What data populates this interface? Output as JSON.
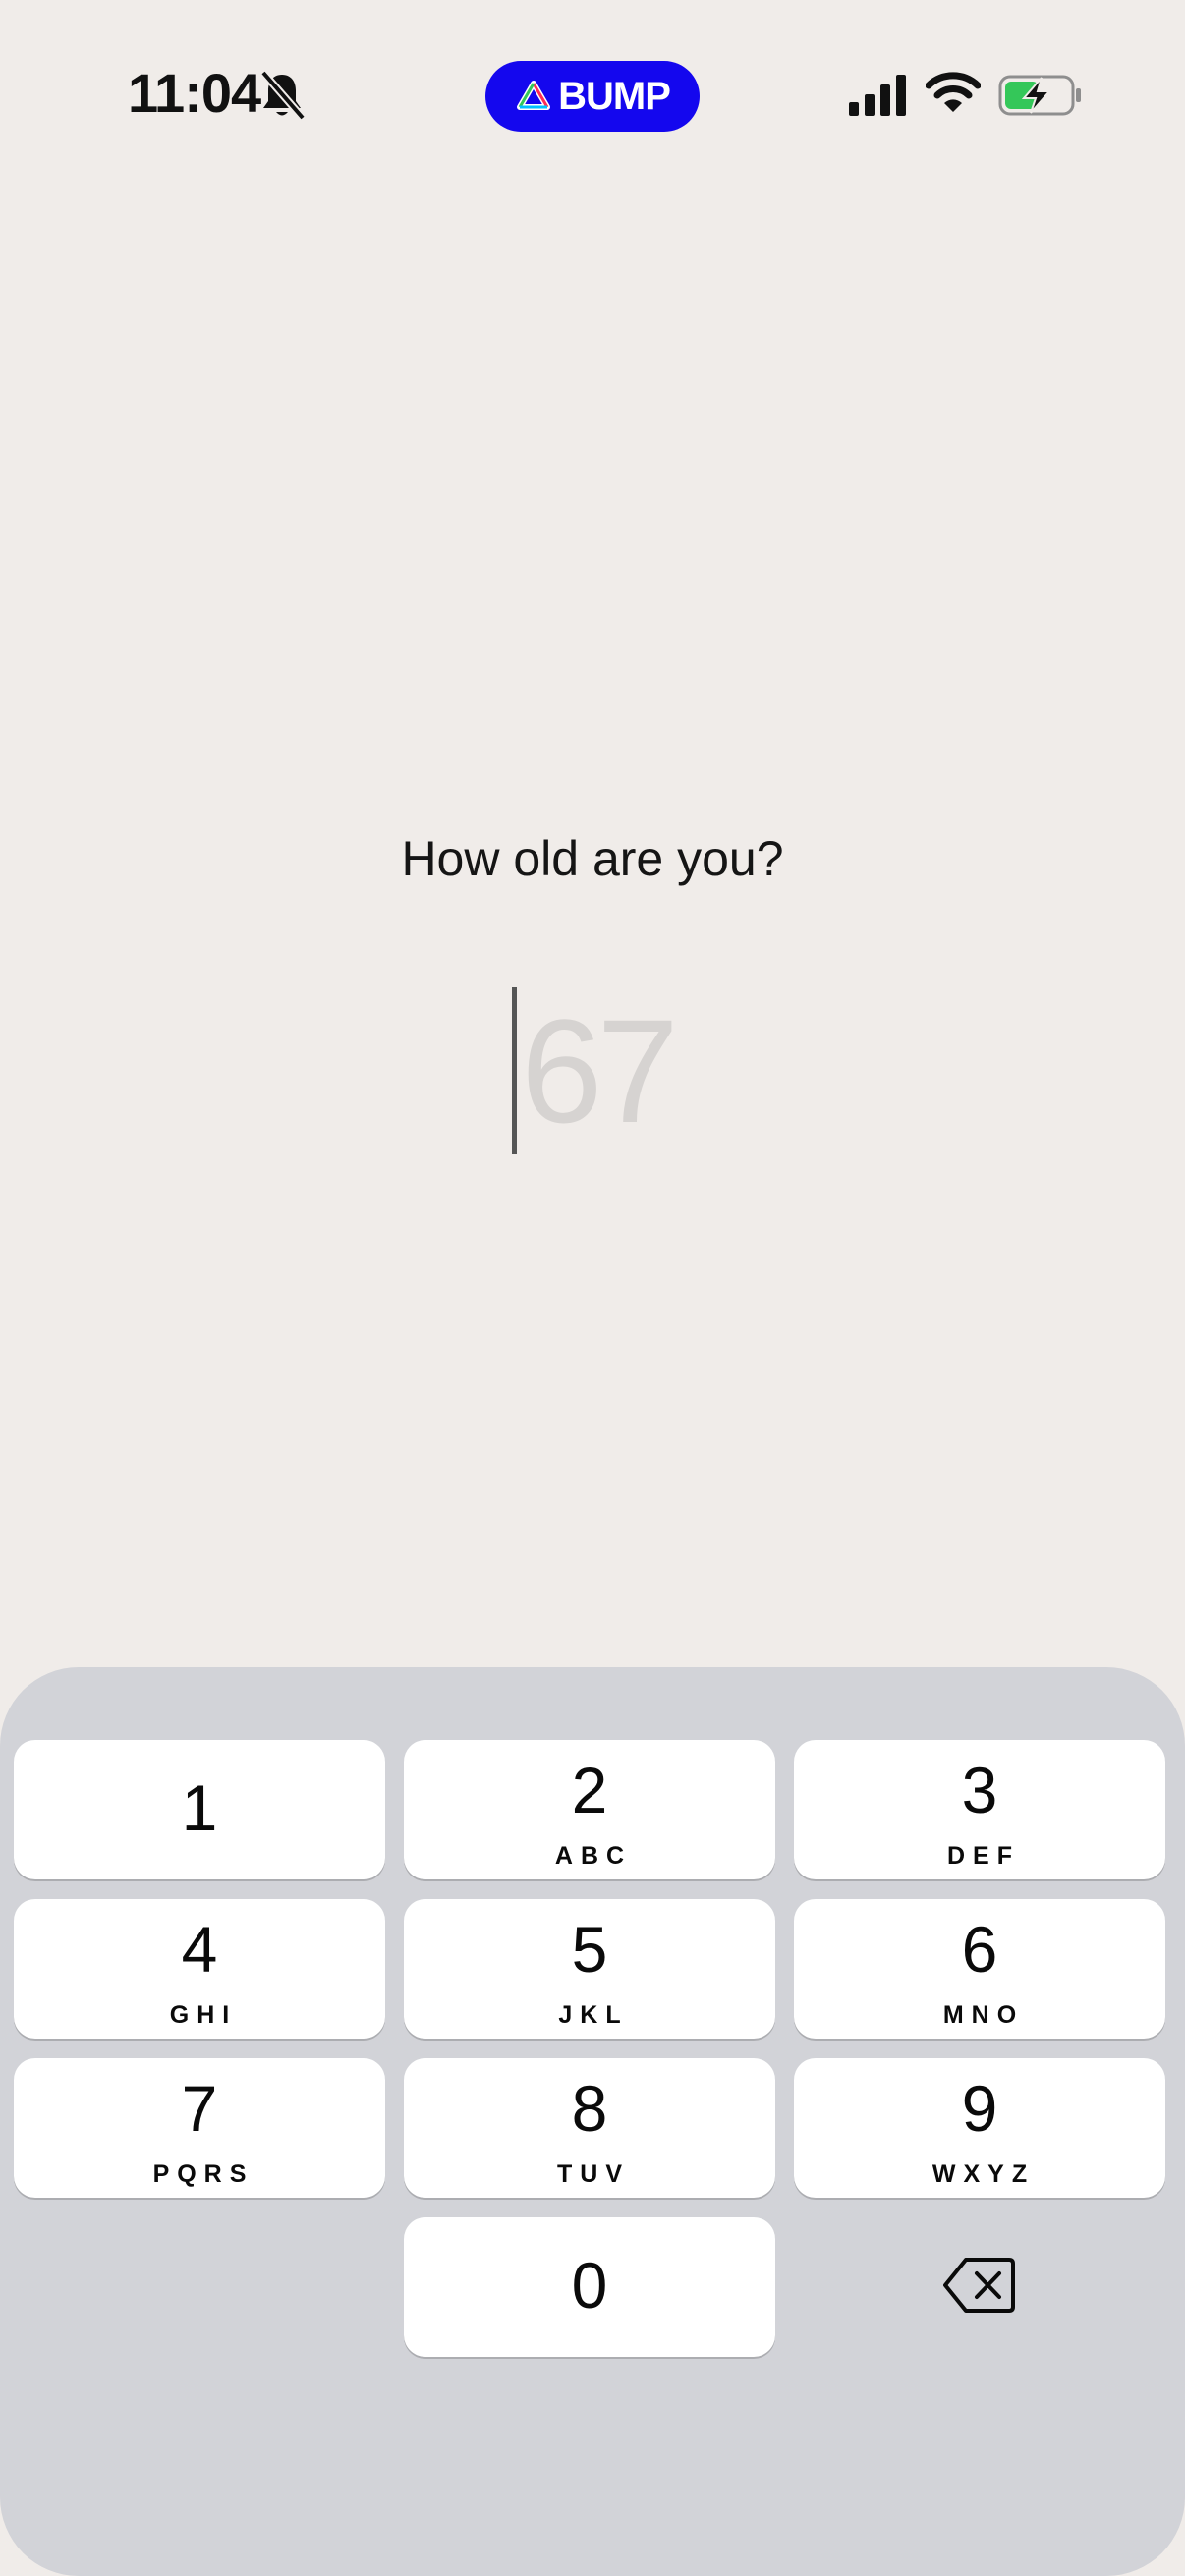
{
  "status_bar": {
    "time": "11:04",
    "app_pill": "BUMP",
    "pill_color": "#1407ee",
    "icons": [
      "bell-slash-icon",
      "bump-logo-icon",
      "cellular-signal-icon",
      "wifi-icon",
      "battery-charging-icon"
    ]
  },
  "prompt": {
    "question": "How old are you?",
    "age_placeholder": "67"
  },
  "keypad": {
    "keys": [
      {
        "digit": "1",
        "letters": ""
      },
      {
        "digit": "2",
        "letters": "ABC"
      },
      {
        "digit": "3",
        "letters": "DEF"
      },
      {
        "digit": "4",
        "letters": "GHI"
      },
      {
        "digit": "5",
        "letters": "JKL"
      },
      {
        "digit": "6",
        "letters": "MNO"
      },
      {
        "digit": "7",
        "letters": "PQRS"
      },
      {
        "digit": "8",
        "letters": "TUV"
      },
      {
        "digit": "9",
        "letters": "WXYZ"
      },
      {
        "digit": "0",
        "letters": ""
      }
    ],
    "delete_icon": "backspace-icon"
  }
}
